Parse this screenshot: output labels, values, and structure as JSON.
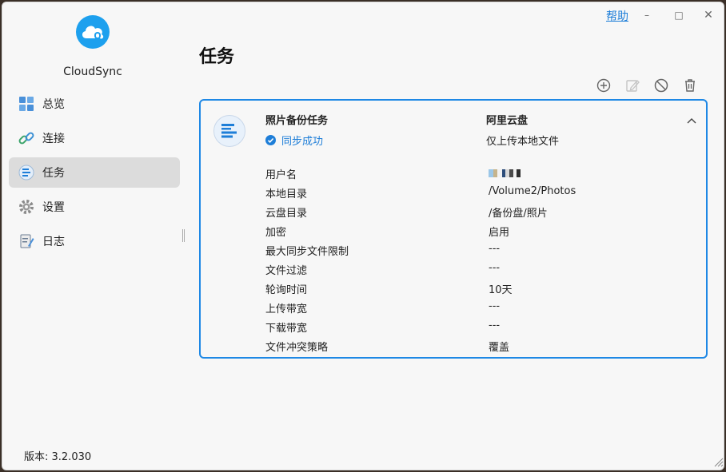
{
  "window": {
    "help_label": "帮助",
    "minimize": "–",
    "maximize": "□",
    "close": "✕"
  },
  "sidebar": {
    "app_name": "CloudSync",
    "items": [
      {
        "label": "总览",
        "icon": "overview-icon"
      },
      {
        "label": "连接",
        "icon": "link-icon"
      },
      {
        "label": "任务",
        "icon": "task-list-icon",
        "active": true
      },
      {
        "label": "设置",
        "icon": "gear-icon"
      },
      {
        "label": "日志",
        "icon": "log-icon"
      }
    ],
    "version": "版本: 3.2.030"
  },
  "main": {
    "title": "任务",
    "toolbar": [
      "add-icon",
      "edit-icon",
      "disable-icon",
      "delete-icon"
    ],
    "task": {
      "name": "照片备份任务",
      "status": "同步成功",
      "cloud": "阿里云盘",
      "direction": "仅上传本地文件",
      "details": [
        {
          "label": "用户名",
          "value": ""
        },
        {
          "label": "本地目录",
          "value": "/Volume2/Photos"
        },
        {
          "label": "云盘目录",
          "value": "/备份盘/照片"
        },
        {
          "label": "加密",
          "value": "启用"
        },
        {
          "label": "最大同步文件限制",
          "value": "---"
        },
        {
          "label": "文件过滤",
          "value": "---"
        },
        {
          "label": "轮询时间",
          "value": "10天"
        },
        {
          "label": "上传带宽",
          "value": "---"
        },
        {
          "label": "下载带宽",
          "value": "---"
        },
        {
          "label": "文件冲突策略",
          "value": "覆盖"
        }
      ]
    }
  },
  "colors": {
    "accent": "#1e88e5",
    "logo": "#1da0ee",
    "active_nav": "#dcdcdc"
  }
}
